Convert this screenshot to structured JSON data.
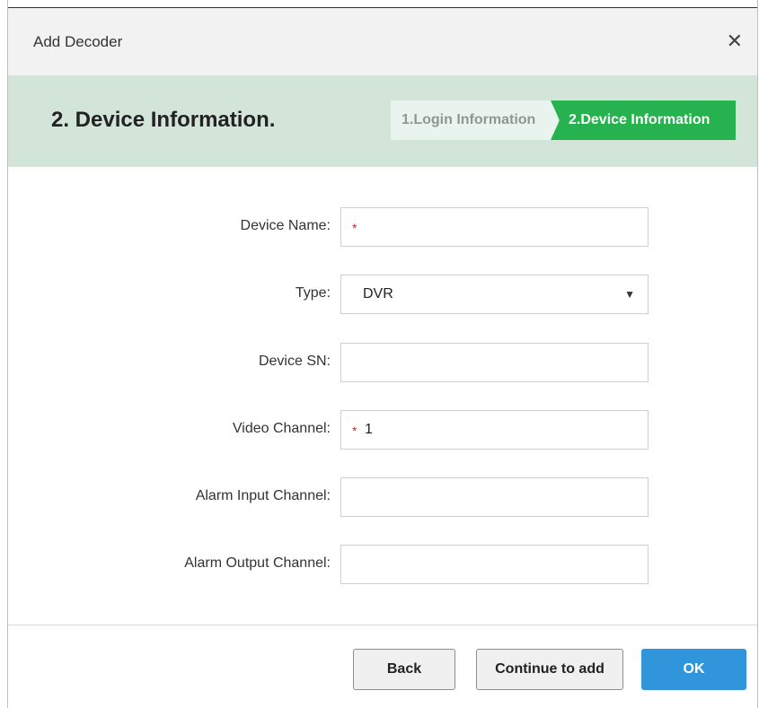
{
  "dialog": {
    "title": "Add Decoder",
    "close_icon": "close-icon"
  },
  "header": {
    "step_title": "2.  Device Information.",
    "steps": [
      {
        "label": "1.Login Information",
        "active": false
      },
      {
        "label": "2.Device Information",
        "active": true
      }
    ]
  },
  "form": {
    "device_name": {
      "label": "Device Name:",
      "value": "",
      "required": true
    },
    "type": {
      "label": "Type:",
      "value": "DVR"
    },
    "device_sn": {
      "label": "Device SN:",
      "value": ""
    },
    "video_channel": {
      "label": "Video Channel:",
      "value": "1",
      "required": true
    },
    "alarm_input": {
      "label": "Alarm Input Channel:",
      "value": ""
    },
    "alarm_output": {
      "label": "Alarm Output Channel:",
      "value": ""
    },
    "required_mark": "*"
  },
  "footer": {
    "back_label": "Back",
    "continue_label": "Continue to add",
    "ok_label": "OK"
  },
  "colors": {
    "accent_green": "#26b24e",
    "header_bg": "#d3e4d9",
    "ok_blue": "#3095db",
    "required_red": "#e02020"
  }
}
